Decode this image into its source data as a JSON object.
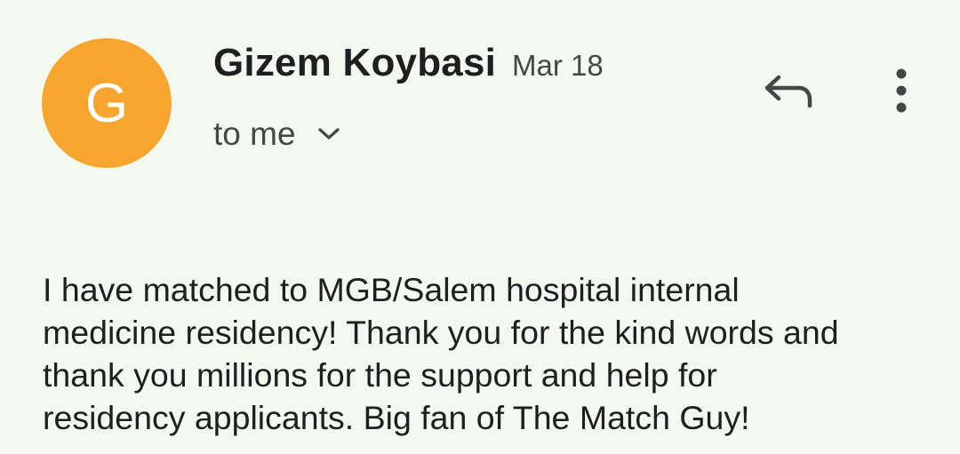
{
  "sender": {
    "initial": "G",
    "name": "Gizem Koybasi",
    "date": "Mar 18",
    "avatar_color": "#f6a52d"
  },
  "recipient": {
    "label": "to me",
    "expand_icon": "chevron-down-icon"
  },
  "actions": {
    "reply_icon": "reply-icon",
    "more_icon": "more-vert-icon"
  },
  "message": {
    "body_lines": [
      "I have matched to MGB/Salem hospital internal",
      "medicine residency! Thank you for the kind words and",
      "thank you millions for the support and help for",
      "residency applicants. Big fan of The Match Guy!"
    ]
  },
  "colors": {
    "background": "#f3f9f1",
    "text_primary": "#1f1f1f",
    "text_secondary": "#444746"
  }
}
